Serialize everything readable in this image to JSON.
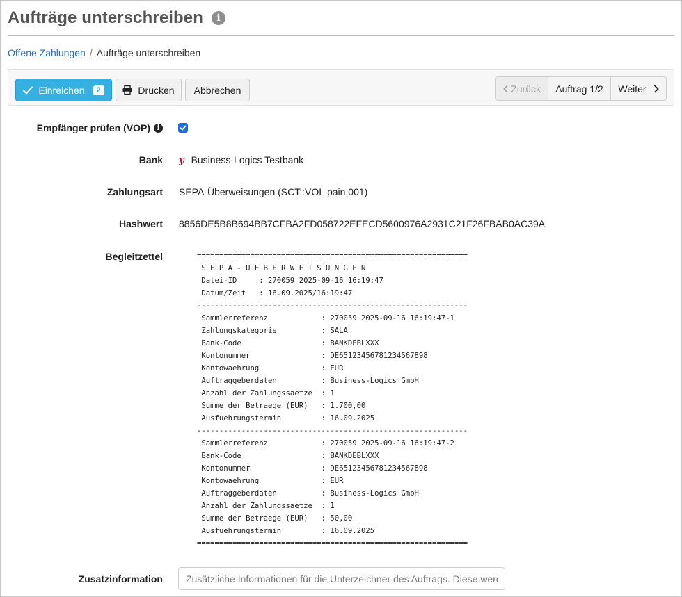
{
  "header": {
    "title": "Aufträge unterschreiben",
    "info_icon": "i"
  },
  "breadcrumb": {
    "parent": "Offene Zahlungen",
    "separator": "/",
    "current": "Aufträge unterschreiben"
  },
  "toolbar": {
    "submit_label": "Einreichen",
    "submit_count": "2",
    "print_label": "Drucken",
    "cancel_label": "Abbrechen",
    "prev_label": "Zurück",
    "position_label": "Auftrag 1/2",
    "next_label": "Weiter"
  },
  "form": {
    "vop_label": "Empfänger prüfen (VOP)",
    "vop_checked": true,
    "bank_label": "Bank",
    "bank_value": "Business-Logics Testbank",
    "type_label": "Zahlungsart",
    "type_value": "SEPA-Überweisungen (SCT::VOI_pain.001)",
    "hash_label": "Hashwert",
    "hash_value": "8856DE5B8B694BB7CFBA2FD058722EFECD5600976A2931C21F26FBAB0AC39A",
    "slip_label": "Begleitzettel",
    "slip_text": "=============================================================\n S E P A - U E B E R W E I S U N G E N\n Datei-ID     : 270059 2025-09-16 16:19:47\n Datum/Zeit   : 16.09.2025/16:19:47\n-------------------------------------------------------------\n Sammlerreferenz            : 270059 2025-09-16 16:19:47-1\n Zahlungskategorie          : SALA\n Bank-Code                  : BANKDEBLXXX\n Kontonummer                : DE65123456781234567898\n Kontowaehrung              : EUR\n Auftraggeberdaten          : Business-Logics GmbH\n Anzahl der Zahlungssaetze  : 1\n Summe der Betraege (EUR)   : 1.700,00\n Ausfuehrungstermin         : 16.09.2025\n-------------------------------------------------------------\n Sammlerreferenz            : 270059 2025-09-16 16:19:47-2\n Bank-Code                  : BANKDEBLXXX\n Kontonummer                : DE65123456781234567898\n Kontowaehrung              : EUR\n Auftraggeberdaten          : Business-Logics GmbH\n Anzahl der Zahlungssaetze  : 1\n Summe der Betraege (EUR)   : 50,00\n Ausfuehrungstermin         : 16.09.2025\n=============================================================",
    "extra_label": "Zusatzinformation",
    "extra_placeholder": "Zusätzliche Informationen für die Unterzeichner des Auftrags. Diese werden"
  }
}
